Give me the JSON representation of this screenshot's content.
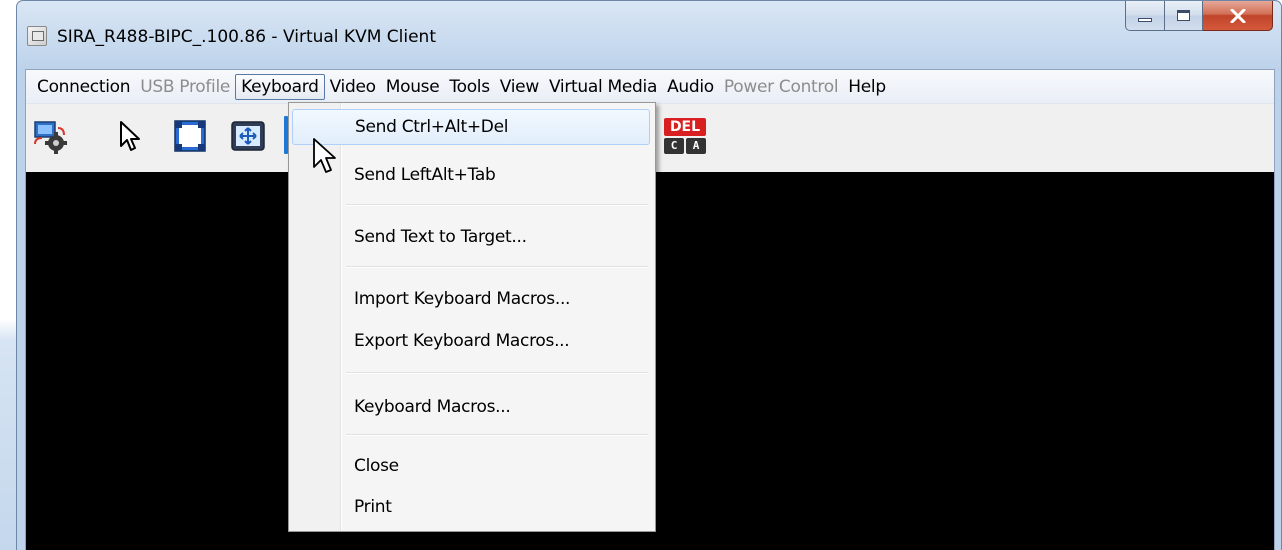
{
  "window": {
    "title": "SIRA_R488-BIPC_.100.86 - Virtual KVM Client",
    "icons": [
      "app-icon",
      "minimize-icon",
      "maximize-icon",
      "close-icon"
    ]
  },
  "menubar": {
    "items": [
      {
        "label": "Connection",
        "state": "enabled"
      },
      {
        "label": "USB Profile",
        "state": "disabled"
      },
      {
        "label": "Keyboard",
        "state": "active"
      },
      {
        "label": "Video",
        "state": "enabled"
      },
      {
        "label": "Mouse",
        "state": "enabled"
      },
      {
        "label": "Tools",
        "state": "enabled"
      },
      {
        "label": "View",
        "state": "enabled"
      },
      {
        "label": "Virtual Media",
        "state": "enabled"
      },
      {
        "label": "Audio",
        "state": "enabled"
      },
      {
        "label": "Power Control",
        "state": "disabled"
      },
      {
        "label": "Help",
        "state": "enabled"
      }
    ]
  },
  "toolbar": {
    "icons": [
      "settings-icon",
      "pointer-icon",
      "fullscreen-icon",
      "fit-window-icon",
      "ctrl-alt-del-icon"
    ],
    "del_icon": {
      "top": "DEL",
      "keys": [
        "C",
        "A"
      ]
    }
  },
  "keyboard_menu": {
    "items": [
      {
        "label": "Send Ctrl+Alt+Del",
        "highlighted": true
      },
      {
        "label": "Send LeftAlt+Tab"
      },
      {
        "label": "Send Text to Target..."
      },
      {
        "label": "Import Keyboard Macros..."
      },
      {
        "label": "Export Keyboard Macros..."
      },
      {
        "label": "Keyboard Macros..."
      },
      {
        "label": "Close"
      },
      {
        "label": "Print"
      }
    ]
  },
  "colors": {
    "video_background": "#000000",
    "menu_highlight_border": "#aecff7",
    "del_badge": "#d82020",
    "disabled_text": "#8d8d8d"
  }
}
